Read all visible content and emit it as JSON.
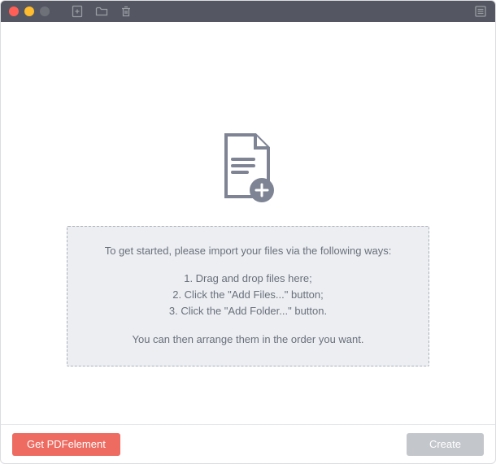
{
  "titlebar": {
    "icons": {
      "add_file": "add-file-icon",
      "add_folder": "folder-icon",
      "trash": "trash-icon",
      "list": "list-icon"
    }
  },
  "hint": {
    "intro": "To get started, please import your files via the following ways:",
    "step1": "1. Drag and drop files here;",
    "step2": "2. Click the \"Add Files...\" button;",
    "step3": "3. Click the \"Add Folder...\" button.",
    "outro": "You can then arrange them in the order you want."
  },
  "buttons": {
    "get_pdfelement": "Get PDFelement",
    "create": "Create"
  }
}
